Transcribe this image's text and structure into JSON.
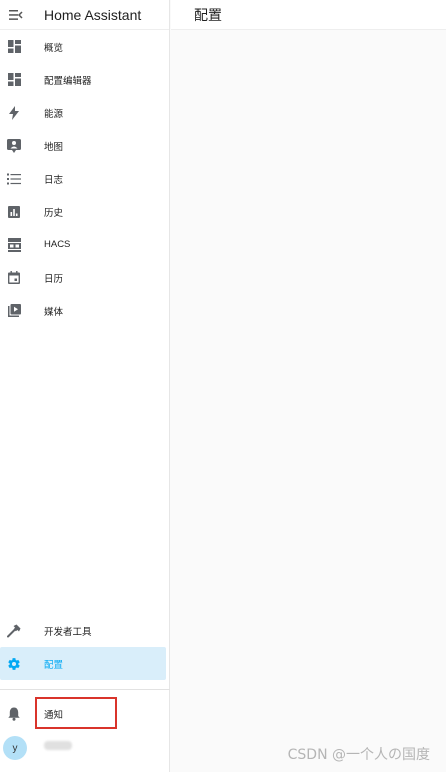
{
  "sidebar": {
    "title": "Home Assistant",
    "items": [
      {
        "label": "概览",
        "icon": "dashboard-icon"
      },
      {
        "label": "配置编辑器",
        "icon": "dashboard-icon"
      },
      {
        "label": "能源",
        "icon": "lightning-icon"
      },
      {
        "label": "地图",
        "icon": "map-person-icon"
      },
      {
        "label": "日志",
        "icon": "list-icon"
      },
      {
        "label": "历史",
        "icon": "chart-icon"
      },
      {
        "label": "HACS",
        "icon": "hacs-icon"
      },
      {
        "label": "日历",
        "icon": "calendar-icon"
      },
      {
        "label": "媒体",
        "icon": "media-icon"
      }
    ],
    "bottom_items": [
      {
        "label": "开发者工具",
        "icon": "hammer-icon"
      },
      {
        "label": "配置",
        "icon": "gear-icon",
        "selected": true
      }
    ],
    "notifications_label": "通知",
    "user_initial": "y"
  },
  "main": {
    "title": "配置"
  },
  "watermark": "CSDN @一个人の国度",
  "colors": {
    "accent": "#03a9f4",
    "selected_bg": "#d9eefa",
    "highlight_box": "#d9342b"
  }
}
